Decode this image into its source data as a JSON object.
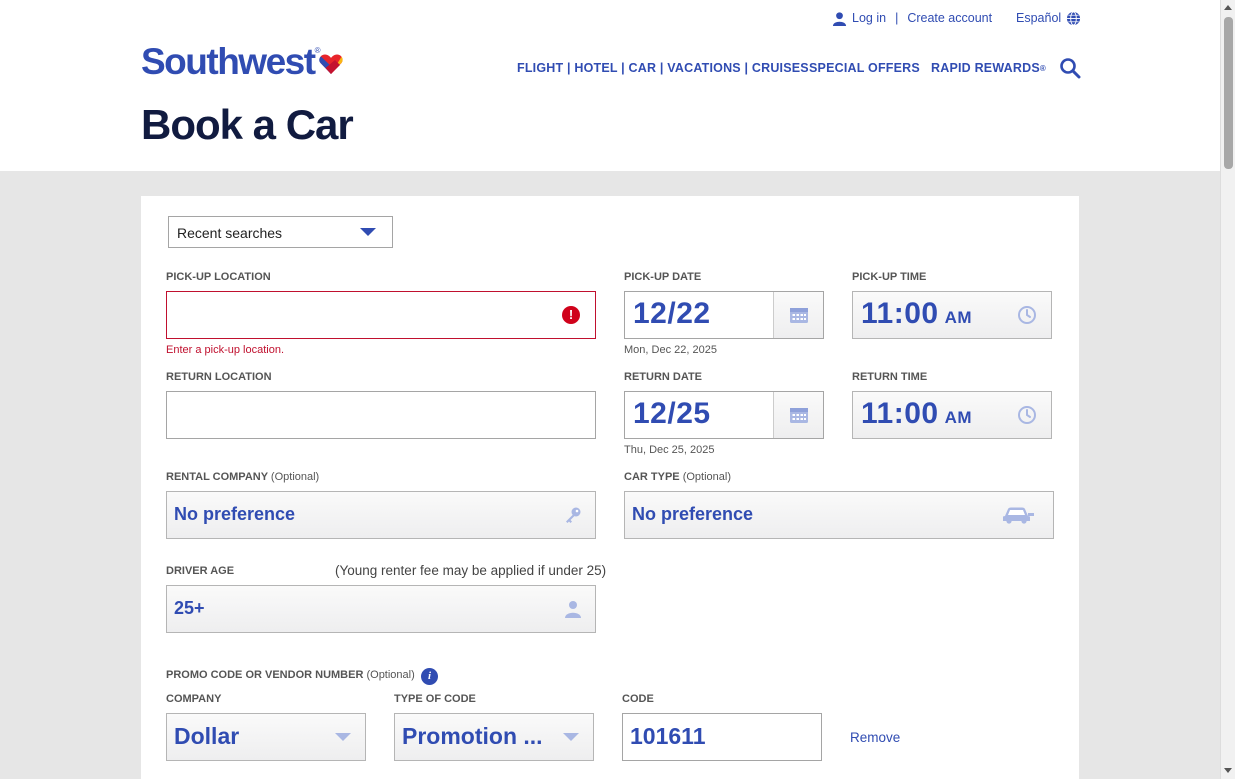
{
  "header": {
    "login_label": "Log in",
    "create_account_label": "Create account",
    "separator": "|",
    "language_label": "Español",
    "logo_text": "Southwest",
    "logo_reg": "®",
    "nav_products": "FLIGHT | HOTEL | CAR | VACATIONS | CRUISES",
    "nav_special_offers": "SPECIAL OFFERS",
    "nav_rapid_rewards": "RAPID REWARDS",
    "nav_rapid_rewards_mark": "®"
  },
  "page_title": "Book a Car",
  "form": {
    "recent_searches": "Recent searches",
    "pickup_location": {
      "label": "PICK-UP LOCATION",
      "value": "",
      "error": "Enter a pick-up location.",
      "error_glyph": "!"
    },
    "return_location": {
      "label": "RETURN LOCATION",
      "value": ""
    },
    "pickup_date": {
      "label": "PICK-UP DATE",
      "value": "12/22",
      "full": "Mon, Dec 22, 2025"
    },
    "return_date": {
      "label": "RETURN DATE",
      "value": "12/25",
      "full": "Thu, Dec 25, 2025"
    },
    "pickup_time": {
      "label": "PICK-UP TIME",
      "value": "11:00",
      "ampm": "AM"
    },
    "return_time": {
      "label": "RETURN TIME",
      "value": "11:00",
      "ampm": "AM"
    },
    "rental_company": {
      "label": "RENTAL COMPANY",
      "optional": "(Optional)",
      "value": "No preference"
    },
    "car_type": {
      "label": "CAR TYPE",
      "optional": "(Optional)",
      "value": "No preference"
    },
    "driver_age": {
      "label": "DRIVER AGE",
      "hint": "(Young renter fee may be applied if under 25)",
      "value": "25+"
    },
    "promo": {
      "label": "PROMO CODE OR VENDOR NUMBER",
      "optional": "(Optional)",
      "info_glyph": "i",
      "company_label": "COMPANY",
      "company_value": "Dollar",
      "type_label": "TYPE OF CODE",
      "type_value": "Promotion ...",
      "code_label": "CODE",
      "code_value": "101611",
      "remove_label": "Remove"
    }
  },
  "colors": {
    "brand_blue": "#304cb2",
    "title_navy": "#111b40",
    "error_red": "#c0102e",
    "page_bg": "#e6e6e6"
  },
  "icons": [
    "user-icon",
    "globe-icon",
    "heart-logo-icon",
    "search-icon",
    "chevron-down-icon",
    "error-icon",
    "calendar-icon",
    "clock-icon",
    "key-icon",
    "car-icon",
    "person-icon",
    "info-icon"
  ]
}
